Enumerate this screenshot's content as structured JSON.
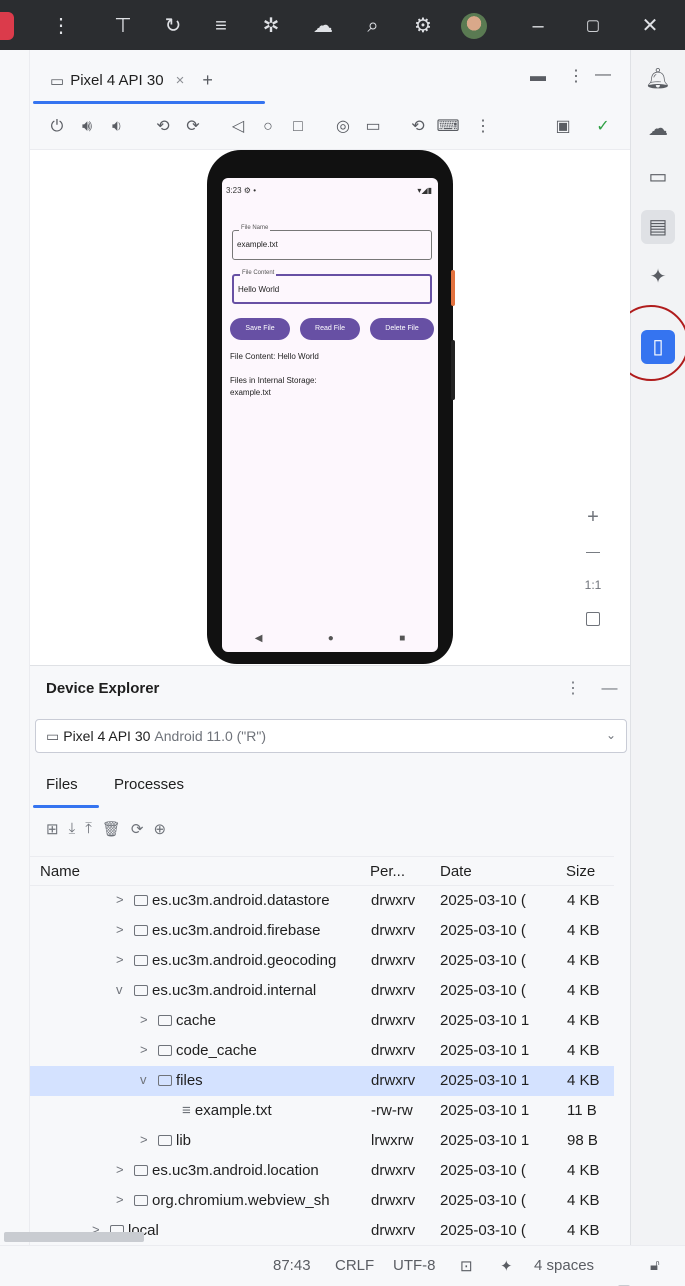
{
  "titlebar": {
    "icons": [
      "kebab-icon",
      "android-run-icon",
      "translate-icon",
      "layout-inspector-icon",
      "bug-icon",
      "profiler-icon",
      "search-icon",
      "settings-icon",
      "avatar",
      "minimize-icon",
      "restore-icon",
      "close-icon"
    ]
  },
  "emulator": {
    "tab_label": "Pixel 4 API 30",
    "tab_close": "×",
    "tab_add": "+",
    "phone": {
      "time": "3:23",
      "field1_label": "File Name",
      "field1_value": "example.txt",
      "field2_label": "File Content",
      "field2_value": "Hello World",
      "btn_save": "Save File",
      "btn_read": "Read File",
      "btn_delete": "Delete File",
      "content_text": "File Content: Hello World",
      "files_label": "Files in Internal Storage:",
      "files_value": "example.txt"
    },
    "zoom": {
      "plus": "+",
      "minus": "—",
      "ratio": "1:1"
    }
  },
  "device_explorer": {
    "title": "Device Explorer",
    "device_name": "Pixel 4 API 30",
    "device_detail": "Android 11.0 (\"R\")",
    "tabs": [
      "Files",
      "Processes"
    ],
    "columns": [
      "Name",
      "Per...",
      "Date",
      "Size"
    ],
    "rows": [
      {
        "name": "es.uc3m.android.datastore",
        "perm": "drwxrv",
        "date": "2025-03-10 (",
        "size": "4 KB",
        "indent": 0,
        "caret": ">",
        "type": "folder"
      },
      {
        "name": "es.uc3m.android.firebase",
        "perm": "drwxrv",
        "date": "2025-03-10 (",
        "size": "4 KB",
        "indent": 0,
        "caret": ">",
        "type": "folder"
      },
      {
        "name": "es.uc3m.android.geocoding",
        "perm": "drwxrv",
        "date": "2025-03-10 (",
        "size": "4 KB",
        "indent": 0,
        "caret": ">",
        "type": "folder"
      },
      {
        "name": "es.uc3m.android.internal",
        "perm": "drwxrv",
        "date": "2025-03-10 (",
        "size": "4 KB",
        "indent": 0,
        "caret": "v",
        "type": "folder"
      },
      {
        "name": "cache",
        "perm": "drwxrv",
        "date": "2025-03-10 1",
        "size": "4 KB",
        "indent": 1,
        "caret": ">",
        "type": "folder"
      },
      {
        "name": "code_cache",
        "perm": "drwxrv",
        "date": "2025-03-10 1",
        "size": "4 KB",
        "indent": 1,
        "caret": ">",
        "type": "folder"
      },
      {
        "name": "files",
        "perm": "drwxrv",
        "date": "2025-03-10 1",
        "size": "4 KB",
        "indent": 1,
        "caret": "v",
        "type": "folder",
        "selected": true
      },
      {
        "name": "example.txt",
        "perm": "-rw-rw",
        "date": "2025-03-10 1",
        "size": "11 B",
        "indent": 2,
        "caret": "",
        "type": "file"
      },
      {
        "name": "lib",
        "perm": "lrwxrw",
        "date": "2025-03-10 1",
        "size": "98 B",
        "indent": 1,
        "caret": ">",
        "type": "link"
      },
      {
        "name": "es.uc3m.android.location",
        "perm": "drwxrv",
        "date": "2025-03-10 (",
        "size": "4 KB",
        "indent": 0,
        "caret": ">",
        "type": "folder"
      },
      {
        "name": "org.chromium.webview_sh",
        "perm": "drwxrv",
        "date": "2025-03-10 (",
        "size": "4 KB",
        "indent": 0,
        "caret": ">",
        "type": "folder"
      },
      {
        "name": "local",
        "perm": "drwxrv",
        "date": "2025-03-10 (",
        "size": "4 KB",
        "indent": -1,
        "caret": ">",
        "type": "folder"
      }
    ]
  },
  "statusbar": {
    "position": "87:43",
    "line_ending": "CRLF",
    "encoding": "UTF-8",
    "indent": "4 spaces"
  }
}
